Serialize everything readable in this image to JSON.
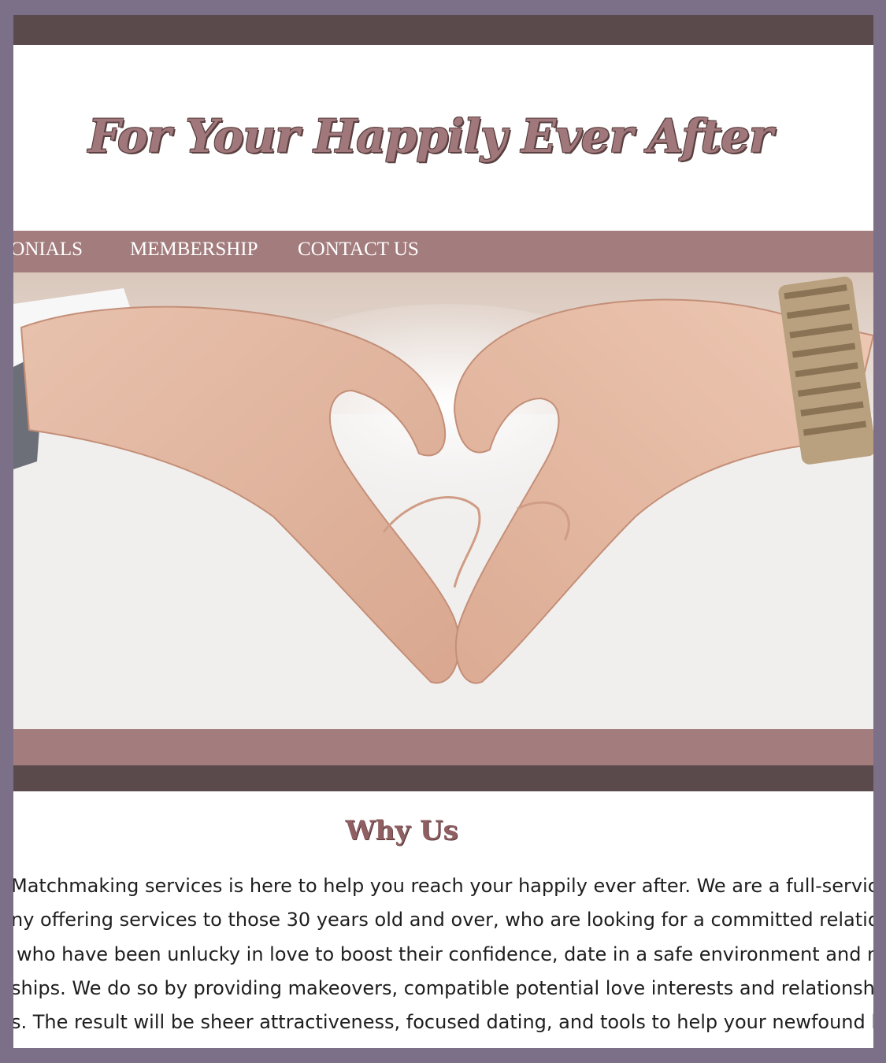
{
  "header": {
    "title": "For Your Happily Ever After"
  },
  "nav": {
    "items": [
      {
        "label": "IONIALS"
      },
      {
        "label": "MEMBERSHIP"
      },
      {
        "label": "CONTACT US"
      }
    ]
  },
  "hero": {
    "image": "heart-hands-image"
  },
  "why_us": {
    "title": "Why Us",
    "lines": [
      "Matchmaking services is here to help you reach your happily ever after. We are a full-service",
      "ny offering services to those 30 years old and over, who are looking for a committed relation",
      "who have been unlucky in love to boost their confidence, date in a safe environment and na",
      "ships. We do so by providing makeovers, compatible potential love interests and relationshi",
      "s. The result will be sheer attractiveness, focused dating, and tools to help your newfound lo"
    ]
  },
  "colors": {
    "page_border": "#7c7089",
    "dark_bar": "#5b4a4c",
    "nav_bar": "#a37c7d",
    "title_text": "#a0777b"
  }
}
